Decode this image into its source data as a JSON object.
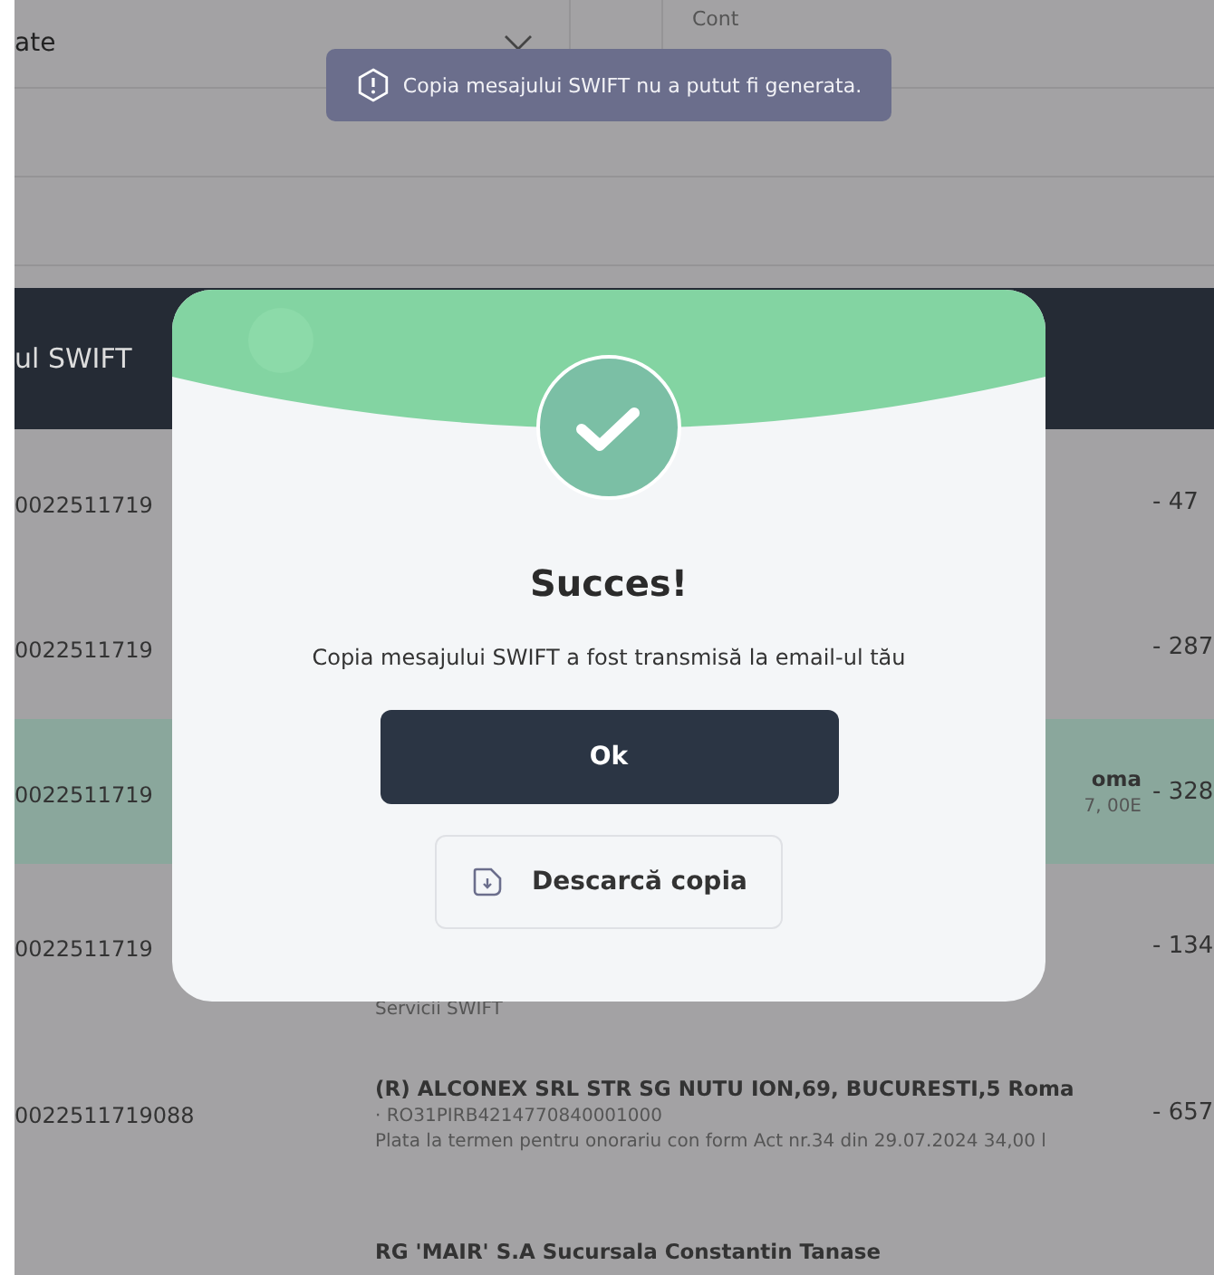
{
  "filters": {
    "select_value": "ate",
    "account_label": "Cont"
  },
  "toast": {
    "message": "Copia mesajului SWIFT nu a putut fi generata."
  },
  "table": {
    "header": "ul SWIFT",
    "rows": [
      {
        "id": "0022511719",
        "amount": "- 47",
        "selected": false
      },
      {
        "id": "0022511719",
        "amount": "- 287",
        "selected": false
      },
      {
        "id": "0022511719",
        "amount": "- 328",
        "selected": true,
        "name": "oma",
        "detail": "7, 00E"
      },
      {
        "id": "0022511719",
        "amount": "- 134",
        "selected": false,
        "detail": "Servicii SWIFT"
      },
      {
        "id": "0022511719088",
        "amount": "- 657",
        "selected": false,
        "name": "(R) ALCONEX SRL STR SG NUTU ION,69, BUCURESTI,5 Roma",
        "iban": "· RO31PIRB4214770840001000",
        "detail": "Plata la termen pentru onorariu con form Act nr.34 din 29.07.2024 34,00 l"
      },
      {
        "selected": false,
        "name": "RG 'MAIR' S.A Sucursala Constantin Tanase"
      }
    ]
  },
  "modal": {
    "title": "Succes!",
    "message": "Copia mesajului SWIFT a fost transmisă la email-ul tău",
    "primary_button": "Ok",
    "secondary_button": "Descarcă copia"
  }
}
